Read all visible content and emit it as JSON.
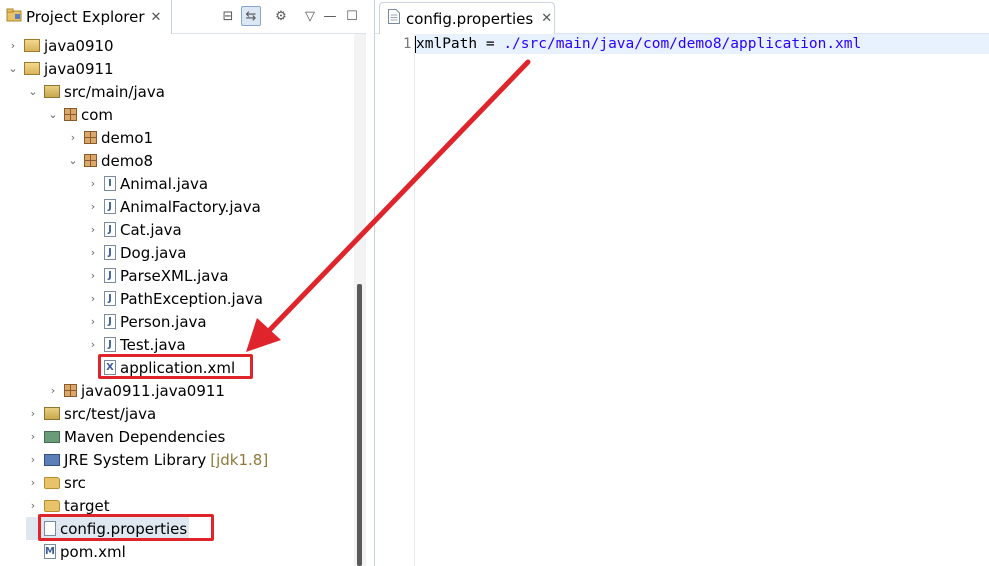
{
  "explorer": {
    "title": "Project Explorer",
    "close_glyph": "✕",
    "toolbar": [
      {
        "name": "collapse-all-icon",
        "glyph": "⊟"
      },
      {
        "name": "link-with-editor-icon",
        "glyph": "⇆"
      },
      {
        "name": "focus-workspace-icon",
        "glyph": "⚙"
      },
      {
        "name": "view-menu-icon",
        "glyph": "▽"
      },
      {
        "name": "minimize-icon",
        "glyph": "—"
      },
      {
        "name": "maximize-icon",
        "glyph": "☐"
      }
    ],
    "tree": [
      {
        "label": "java0910",
        "depth": 0,
        "arrow": "›",
        "icon": "project-icon"
      },
      {
        "label": "java0911",
        "depth": 0,
        "arrow": "⌄",
        "icon": "project-icon"
      },
      {
        "label": "src/main/java",
        "depth": 1,
        "arrow": "⌄",
        "icon": "source-folder-icon"
      },
      {
        "label": "com",
        "depth": 2,
        "arrow": "⌄",
        "icon": "package-icon"
      },
      {
        "label": "demo1",
        "depth": 3,
        "arrow": "›",
        "icon": "package-icon"
      },
      {
        "label": "demo8",
        "depth": 3,
        "arrow": "⌄",
        "icon": "package-icon"
      },
      {
        "label": "Animal.java",
        "depth": 4,
        "arrow": "›",
        "icon": "java-interface-icon"
      },
      {
        "label": "AnimalFactory.java",
        "depth": 4,
        "arrow": "›",
        "icon": "java-file-icon"
      },
      {
        "label": "Cat.java",
        "depth": 4,
        "arrow": "›",
        "icon": "java-file-icon"
      },
      {
        "label": "Dog.java",
        "depth": 4,
        "arrow": "›",
        "icon": "java-file-icon"
      },
      {
        "label": "ParseXML.java",
        "depth": 4,
        "arrow": "›",
        "icon": "java-file-icon"
      },
      {
        "label": "PathException.java",
        "depth": 4,
        "arrow": "›",
        "icon": "java-file-icon"
      },
      {
        "label": "Person.java",
        "depth": 4,
        "arrow": "›",
        "icon": "java-file-icon"
      },
      {
        "label": "Test.java",
        "depth": 4,
        "arrow": "›",
        "icon": "java-file-icon"
      },
      {
        "label": "application.xml",
        "depth": 4,
        "arrow": "",
        "icon": "xml-file-icon"
      },
      {
        "label": "java0911.java0911",
        "depth": 2,
        "arrow": "›",
        "icon": "package-icon"
      },
      {
        "label": "src/test/java",
        "depth": 1,
        "arrow": "›",
        "icon": "source-folder-icon"
      },
      {
        "label": "Maven Dependencies",
        "depth": 1,
        "arrow": "›",
        "icon": "library-icon"
      },
      {
        "label": "JRE System Library",
        "decor": "[jdk1.8]",
        "depth": 1,
        "arrow": "›",
        "icon": "jre-library-icon"
      },
      {
        "label": "src",
        "depth": 1,
        "arrow": "›",
        "icon": "folder-icon"
      },
      {
        "label": "target",
        "depth": 1,
        "arrow": "›",
        "icon": "folder-icon"
      },
      {
        "label": "config.properties",
        "depth": 1,
        "arrow": "",
        "icon": "properties-file-icon"
      },
      {
        "label": "pom.xml",
        "depth": 1,
        "arrow": "",
        "icon": "maven-file-icon"
      }
    ]
  },
  "editor": {
    "tab_label": "config.properties",
    "close_glyph": "✕",
    "line_number": "1",
    "code_key": "xmlPath = ",
    "code_value": "./src/main/java/com/demo8/application.xml"
  },
  "colors": {
    "annotation_red": "#e0242b",
    "current_line": "#e8f2fe",
    "property_value": "#2a00ff"
  }
}
